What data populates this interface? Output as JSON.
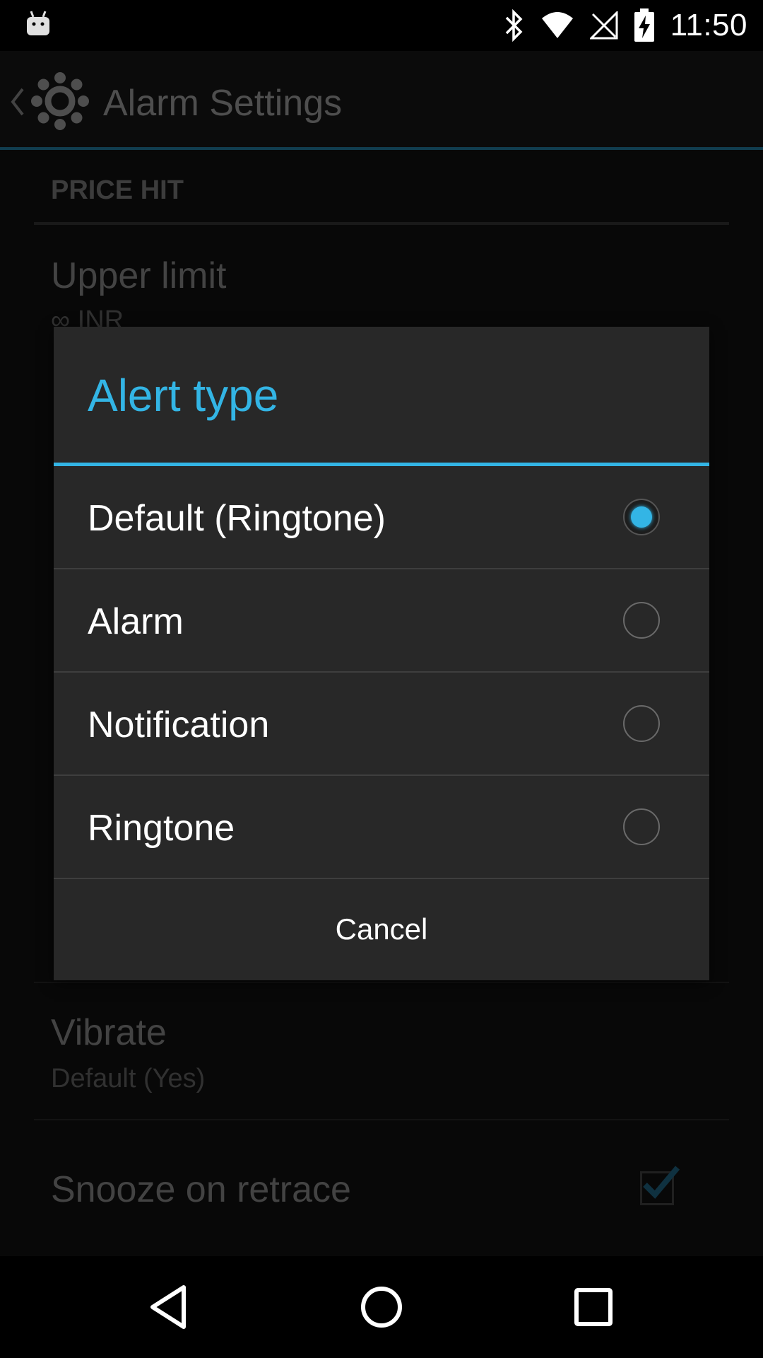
{
  "status_bar": {
    "time": "11:50",
    "icons": [
      "android-notification-icon",
      "bluetooth-icon",
      "wifi-icon",
      "no-sim-icon",
      "battery-charging-icon"
    ]
  },
  "action_bar": {
    "title": "Alarm Settings",
    "icon": "gear-icon"
  },
  "settings": {
    "category": "PRICE HIT",
    "upper_limit": {
      "title": "Upper limit",
      "summary": "∞ INR"
    },
    "vibrate": {
      "title": "Vibrate",
      "summary": "Default (Yes)"
    },
    "snooze": {
      "title": "Snooze on retrace",
      "checked": true
    }
  },
  "dialog": {
    "title": "Alert type",
    "options": [
      {
        "label": "Default (Ringtone)",
        "selected": true
      },
      {
        "label": "Alarm",
        "selected": false
      },
      {
        "label": "Notification",
        "selected": false
      },
      {
        "label": "Ringtone",
        "selected": false
      }
    ],
    "cancel_label": "Cancel"
  },
  "colors": {
    "accent": "#33b5e5",
    "action_bar_divider": "#1f6f91",
    "dialog_bg": "#282828"
  },
  "nav_bar": {
    "icons": [
      "back-icon",
      "home-icon",
      "recents-icon"
    ]
  }
}
